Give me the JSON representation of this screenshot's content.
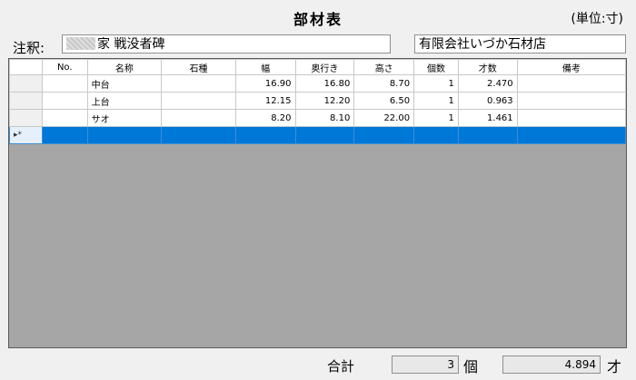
{
  "title": "部材表",
  "unit_label": "(単位:寸)",
  "note": {
    "label": "注釈:",
    "value": "家 戦没者碑"
  },
  "shop": "有限会社いづか石材店",
  "table": {
    "columns": [
      "",
      "No.",
      "名称",
      "石種",
      "幅",
      "奥行き",
      "高さ",
      "個数",
      "才数",
      "備考"
    ],
    "rows": [
      {
        "no": "",
        "name": "中台",
        "stone": "",
        "width": "16.90",
        "depth": "16.80",
        "height": "8.70",
        "qty": "1",
        "sai": "2.470",
        "remarks": ""
      },
      {
        "no": "",
        "name": "上台",
        "stone": "",
        "width": "12.15",
        "depth": "12.20",
        "height": "6.50",
        "qty": "1",
        "sai": "0.963",
        "remarks": ""
      },
      {
        "no": "",
        "name": "サオ",
        "stone": "",
        "width": "8.20",
        "depth": "8.10",
        "height": "22.00",
        "qty": "1",
        "sai": "1.461",
        "remarks": ""
      }
    ],
    "new_row_marker": "▸*"
  },
  "totals": {
    "label": "合計",
    "count": "3",
    "count_unit": "個",
    "sai": "4.894",
    "sai_unit": "才"
  },
  "colors": {
    "selection": "#0078d7",
    "grid_empty": "#a6a6a6"
  }
}
